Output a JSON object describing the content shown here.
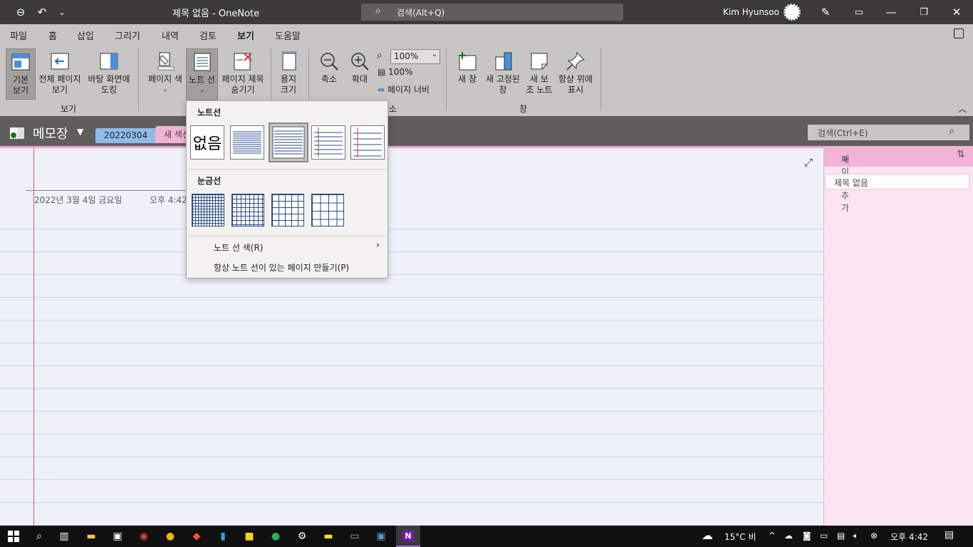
{
  "titlebar": {
    "title": "제목 없음  -  OneNote",
    "search": "검색(Alt+Q)",
    "user": "Kim Hyunsoo"
  },
  "menu": {
    "tabs": [
      "파일",
      "홈",
      "삽입",
      "그리기",
      "내역",
      "검토",
      "보기",
      "도움말"
    ],
    "active": "보기"
  },
  "ribbon": {
    "normal_view": "기본\n보기",
    "full_page_view": "전체 페이지\n보기",
    "dock_to_desktop": "바탕 화면에\n도킹",
    "group_view": "보기",
    "page_color": "페이지 색",
    "rule_lines": "노트 선",
    "hide_page_title": "페이지 제목\n숨기기",
    "paper_size": "용지\n크기",
    "zoom_out": "축소",
    "zoom_in": "확대",
    "zoom_value": "100%",
    "zoom_100": "100%",
    "page_width": "페이지 너비",
    "zoom_group_partial": "소",
    "new_window": "새 창",
    "new_docked_window": "새 고정된\n창",
    "new_side_note": "새 보\n조 노트",
    "always_on_top": "항상 위에\n표시",
    "group_window": "창"
  },
  "notebook": {
    "name": "메모장",
    "sections": [
      {
        "label": "20220304",
        "color": "#8fbbe8"
      },
      {
        "label": "새 섹션",
        "color": "#f2b3d6"
      }
    ],
    "search": "검색(Ctrl+E)"
  },
  "page": {
    "date": "2022년 3월 4일 금요일",
    "time": "오후 4:42"
  },
  "pages_pane": {
    "add_page": "페이지 추가",
    "pages": [
      "제목 없음"
    ]
  },
  "dropdown": {
    "rule_lines_header": "노트선",
    "none_label": "없음",
    "grid_header": "눈금선",
    "rule_line_color": "노트 선 색(R)",
    "always_create": "항상 노트 선이 있는 페이지 만들기(P)"
  },
  "taskbar": {
    "weather": "15°C  비",
    "time": "오후 4:42"
  },
  "colors": {
    "titlebar": "#3b3a39",
    "ribbon": "#c8c6c4",
    "page_bg": "#eef1fa",
    "rule_line": "#c5d5ec",
    "margin_line": "#e05656",
    "onenote_purple": "#7719aa"
  }
}
